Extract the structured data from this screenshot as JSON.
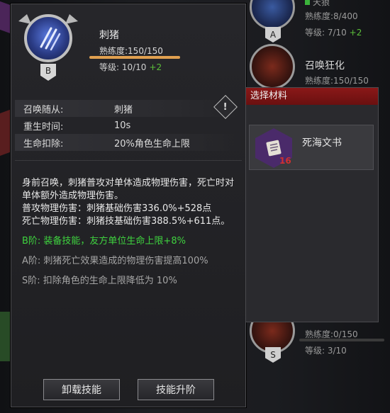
{
  "background_skills": [
    {
      "name": "天狼",
      "proficiency": "熟练度:8/400",
      "level": "等级: 7/10",
      "level_plus": "+2",
      "grade": "A"
    },
    {
      "name": "召唤狂化",
      "proficiency": "熟练度:150/150",
      "grade": ""
    },
    {
      "proficiency": "熟练度:0/150",
      "level": "等级: 3/10",
      "grade": "S"
    }
  ],
  "skill": {
    "name": "刺猪",
    "grade": "B",
    "proficiency": "熟练度:150/150",
    "proficiency_fraction": 1.0,
    "level": "等级: 10/10",
    "level_plus": "+2"
  },
  "info_table": [
    {
      "key": "召唤随从:",
      "value": "刺猪"
    },
    {
      "key": "重生时间:",
      "value": "10s"
    },
    {
      "key": "生命扣除:",
      "value": "20%角色生命上限"
    }
  ],
  "description": {
    "main": "身前召唤，刺猪普攻对单体造成物理伤害，死亡时对单体额外造成物理伤害。",
    "attack": "普攻物理伤害：刺猪基础伤害336.0%+528点",
    "death": "死亡物理伤害：刺猪技基础伤害388.5%+611点。",
    "b_tier": "B阶: 装备技能，友方单位生命上限+8%",
    "a_tier": "A阶: 刺猪死亡效果造成的物理伤害提高100%",
    "s_tier": "S阶: 扣除角色的生命上限降低为 10%"
  },
  "buttons": {
    "unload": "卸载技能",
    "upgrade": "技能升阶"
  },
  "warning_icon": "!",
  "material_popup": {
    "title": "选择材料",
    "item_name": "死海文书",
    "item_count": "16"
  },
  "colors": {
    "accent_red": "#7a1414",
    "green_text": "#3fd33f",
    "proficiency_bar": "#e0a050"
  }
}
